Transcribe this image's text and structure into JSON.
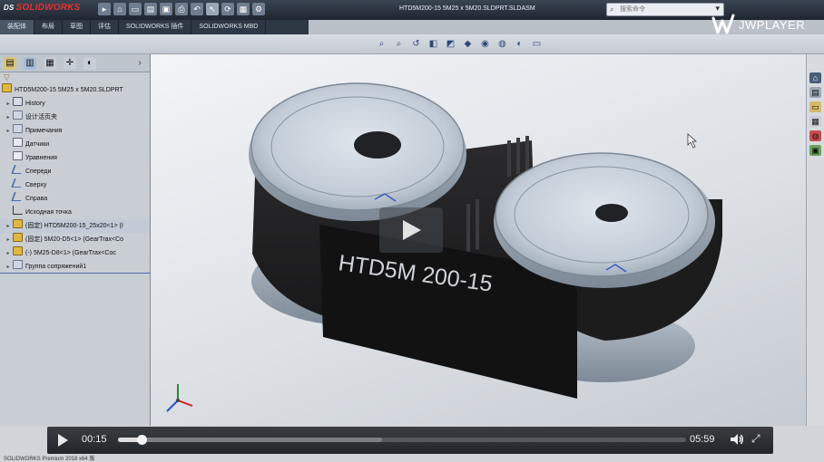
{
  "app": {
    "brand_prefix": "DS",
    "brand_name": "SOLIDWORKS",
    "document_title": "HTD5M200-15 5M25 x 5M20.SLDPRT.SLDASM"
  },
  "search": {
    "placeholder": "搜索命令"
  },
  "player_brand": "JWPLAYER",
  "ribbon_tabs": [
    "装配体",
    "布局",
    "草图",
    "评估",
    "SOLIDWORKS 插件",
    "SOLIDWORKS MBD"
  ],
  "feature_tree": {
    "root": "HTD5M200-15 5M25 x 5M20.SLDPRT",
    "items": [
      {
        "label": "History",
        "icon": "history-icon"
      },
      {
        "label": "设计活页夹",
        "icon": "binder-icon"
      },
      {
        "label": "Примечания",
        "icon": "annotations-icon"
      },
      {
        "label": "Датчики",
        "icon": "sensor-icon"
      },
      {
        "label": "Уравнения",
        "icon": "equations-icon"
      },
      {
        "label": "Спереди",
        "icon": "plane-icon"
      },
      {
        "label": "Сверху",
        "icon": "plane-icon"
      },
      {
        "label": "Справа",
        "icon": "plane-icon"
      },
      {
        "label": "Исходная точка",
        "icon": "origin-icon"
      },
      {
        "label": "(固定) HTD5M200-15_25x20<1> (I",
        "icon": "part-icon"
      },
      {
        "label": "(固定) 5M20-D5<1> (GearTrax<Co",
        "icon": "part-icon"
      },
      {
        "label": "(-) 5M25-D8<1> (GearTrax<Coc",
        "icon": "part-icon"
      },
      {
        "label": "Группа сопряжений1",
        "icon": "mates-icon"
      }
    ]
  },
  "model": {
    "belt_label": "HTD5M 200-15"
  },
  "status_bar": {
    "text": "SOLIDWORKS Premium 2018 x64 版"
  },
  "player": {
    "elapsed": "00:15",
    "duration": "05:59",
    "progress": 0.042,
    "buffered": 0.465
  },
  "colors": {
    "titlebar": "#252d37",
    "belt": "#1c1c1d",
    "pulley_face": "#c3ccd6",
    "accent_blue": "#4a6fb3"
  }
}
